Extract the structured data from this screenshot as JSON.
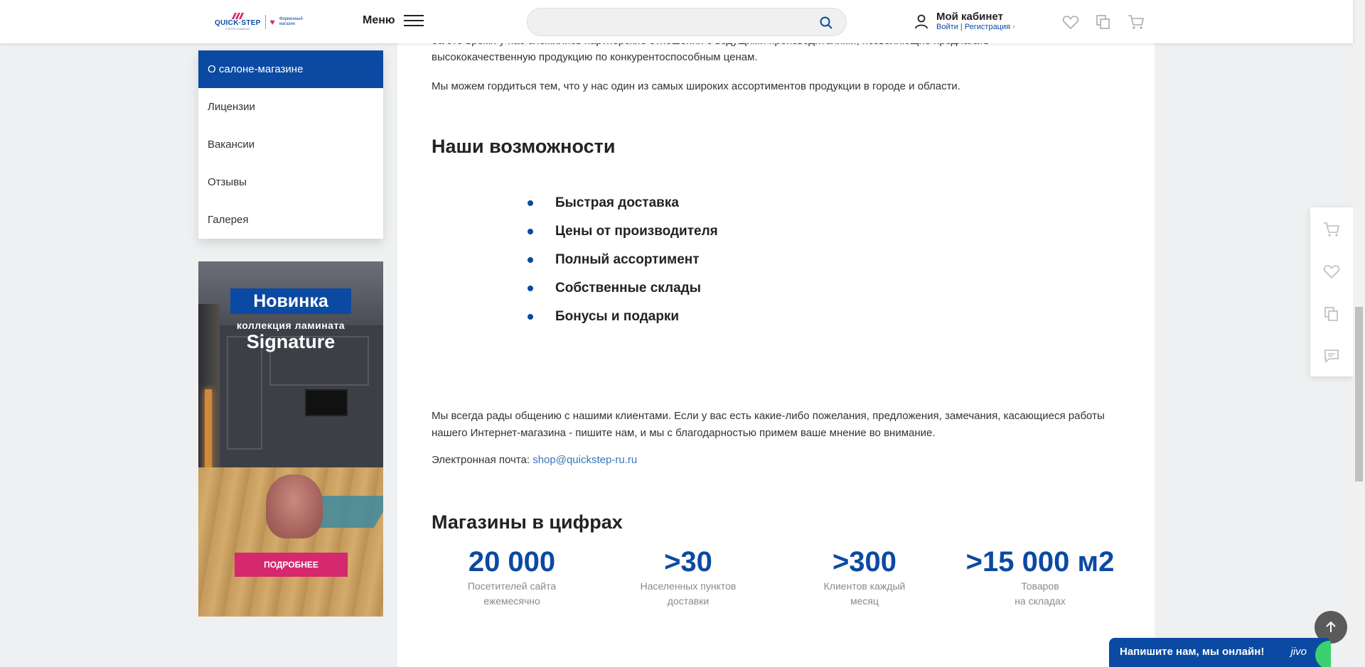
{
  "header": {
    "logo": {
      "brand": "QUICK·STEP",
      "brand_sub": "УЛЬТРА ЛАМИНАТ",
      "store": "Фирменный магазин"
    },
    "menu_label": "Меню",
    "search": {
      "placeholder": ""
    },
    "cabinet": {
      "title": "Мой кабинет",
      "login": "Войти",
      "separator": "|",
      "register": "Регистрация",
      "chevron": "›"
    }
  },
  "sidebar": {
    "items": [
      {
        "label": "О салоне-магазине",
        "active": true
      },
      {
        "label": "Лицензии",
        "active": false
      },
      {
        "label": "Вакансии",
        "active": false
      },
      {
        "label": "Отзывы",
        "active": false
      },
      {
        "label": "Галерея",
        "active": false
      }
    ]
  },
  "banner": {
    "title": "Новинка",
    "subtitle": "коллекция ламината",
    "name": "Signature",
    "button": "ПОДРОБНЕЕ"
  },
  "content": {
    "cut_text": "За это время у нас сложились партнерские отношения с ведущими производителями, позволяющие предлагать",
    "p1": "высококачественную продукцию по конкурентоспособным ценам.",
    "p2": "Мы можем гордиться тем, что у нас один из самых широких ассортиментов продукции в городе и области.",
    "heading_features": "Наши возможности",
    "features": [
      "Быстрая доставка",
      "Цены от производителя",
      "Полный ассортимент",
      "Собственные склады",
      "Бонусы и подарки"
    ],
    "p3": "Мы всегда рады общению с нашими клиентами. Если у вас есть какие-либо пожелания, предложения, замечания, касающиеся работы нашего Интернет-магазина - пишите нам, и мы с благодарностью примем ваше мнение во внимание.",
    "email_label": "Электронная почта:",
    "email": "shop@quickstep-ru.ru",
    "heading_stats": "Магазины в цифрах",
    "stats": [
      {
        "value": "20 000",
        "label1": "Посетителей сайта",
        "label2": "ежемесячно"
      },
      {
        "value": ">30",
        "label1": "Населенных пунктов",
        "label2": "доставки"
      },
      {
        "value": ">300",
        "label1": "Клиентов каждый",
        "label2": "месяц"
      },
      {
        "value": ">15 000 м2",
        "label1": "Товаров",
        "label2": "на складах"
      }
    ]
  },
  "chat": {
    "label": "Напишите нам, мы онлайн!",
    "brand": "jivo"
  },
  "colors": {
    "accent": "#0b4aa2",
    "pink": "#d6286e",
    "link": "#3a74b8"
  }
}
